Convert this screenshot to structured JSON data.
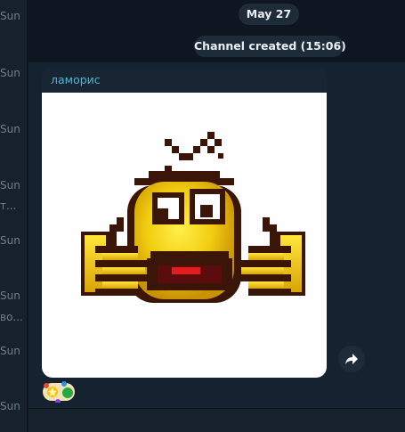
{
  "sidebar": {
    "items": [
      {
        "text": "Sun"
      },
      {
        "text": "Sun"
      },
      {
        "text": "Sun"
      },
      {
        "text": "Sun"
      },
      {
        "text": "т..."
      },
      {
        "text": "Sun"
      },
      {
        "text": "Sun"
      },
      {
        "text": "во..."
      },
      {
        "text": "Sun"
      },
      {
        "text": "Sun"
      }
    ]
  },
  "chat": {
    "date_label": "May 27",
    "service_message": "Channel created (15:06)",
    "message": {
      "sender": "ламорис",
      "media_icon": "pixel-art-yellow-smiley-sticker"
    }
  },
  "icons": {
    "forward": "share-arrow-icon",
    "reaction": "party-emoji-icon"
  },
  "colors": {
    "background": "#0e1621",
    "sidebar": "#17212b",
    "card": "#182533",
    "sender": "#4fb6d6",
    "pill": "#1e2c3a"
  }
}
